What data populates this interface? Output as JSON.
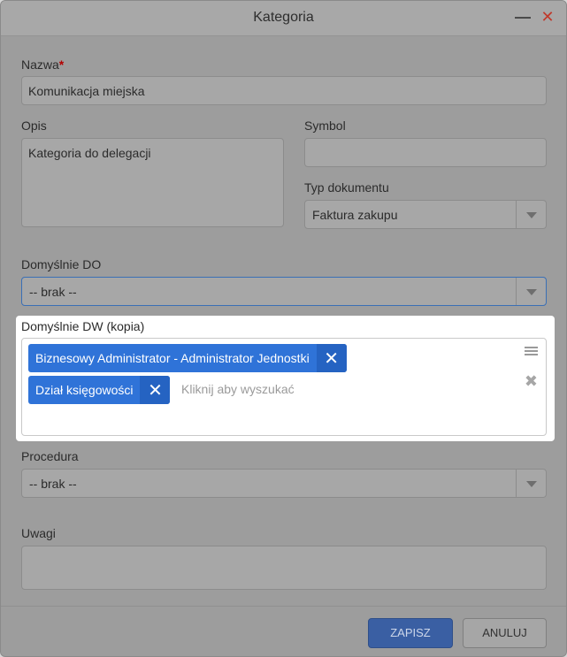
{
  "dialog": {
    "title": "Kategoria"
  },
  "form": {
    "nazwa": {
      "label": "Nazwa",
      "required_mark": "*",
      "value": "Komunikacja miejska"
    },
    "opis": {
      "label": "Opis",
      "value": "Kategoria do delegacji"
    },
    "symbol": {
      "label": "Symbol",
      "value": ""
    },
    "typ_dokumentu": {
      "label": "Typ dokumentu",
      "value": "Faktura zakupu"
    },
    "domyslnie_do": {
      "label": "Domyślnie DO",
      "value": "-- brak --"
    },
    "domyslnie_dw": {
      "label": "Domyślnie DW (kopia)",
      "tags": [
        "Biznesowy Administrator - Administrator Jednostki",
        "Dział księgowości"
      ],
      "placeholder": "Kliknij aby wyszukać"
    },
    "procedura": {
      "label": "Procedura",
      "value": "-- brak --"
    },
    "uwagi": {
      "label": "Uwagi",
      "value": ""
    }
  },
  "buttons": {
    "save": "ZAPISZ",
    "cancel": "ANULUJ"
  },
  "icons": {
    "minimize": "minimize-icon",
    "close": "close-icon",
    "tag_remove": "close-icon",
    "list": "list-icon",
    "clear": "clear-icon",
    "dropdown": "chevron-down-icon"
  },
  "colors": {
    "accent": "#2f73d8",
    "close": "#c0392b",
    "required": "#b30000"
  }
}
